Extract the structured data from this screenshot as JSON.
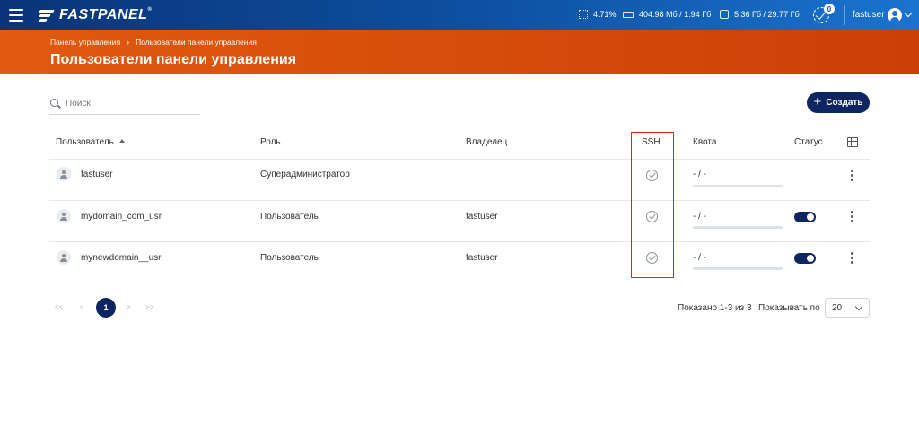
{
  "header": {
    "logo_text": "FASTPANEL",
    "logo_mark": "®",
    "stats": {
      "cpu": "4.71%",
      "ram": "404.98 Мб / 1.94 Гб",
      "disk": "5.36 Гб / 29.77 Гб"
    },
    "notifications_count": "0",
    "user_name": "fastuser"
  },
  "banner": {
    "breadcrumb": [
      "Панель управления",
      "Пользователи панели управления"
    ],
    "breadcrumb_sep": "›",
    "title": "Пользователи панели управления"
  },
  "toolbar": {
    "search_placeholder": "Поиск",
    "create_label": "Создать"
  },
  "table": {
    "columns": {
      "user": "Пользователь",
      "role": "Роль",
      "owner": "Владелец",
      "ssh": "SSH",
      "quota": "Квота",
      "status": "Статус"
    },
    "rows": [
      {
        "user": "fastuser",
        "role": "Суперадминистратор",
        "owner": "",
        "ssh": true,
        "quota": "- / -",
        "status_toggle": false
      },
      {
        "user": "mydomain_com_usr",
        "role": "Пользователь",
        "owner": "fastuser",
        "ssh": true,
        "quota": "- / -",
        "status_toggle": true
      },
      {
        "user": "mynewdomain__usr",
        "role": "Пользователь",
        "owner": "fastuser",
        "ssh": true,
        "quota": "- / -",
        "status_toggle": true
      }
    ]
  },
  "pagination": {
    "first": "<<",
    "prev": "<",
    "current": "1",
    "next": ">",
    "last": ">>",
    "shown_text": "Показано 1-3 из 3",
    "per_page_label": "Показывать по",
    "per_page_value": "20"
  },
  "colors": {
    "topbar": "#0d4fa0",
    "banner": "#d54a0a",
    "primary": "#0d2561",
    "highlight": "#e32020"
  }
}
